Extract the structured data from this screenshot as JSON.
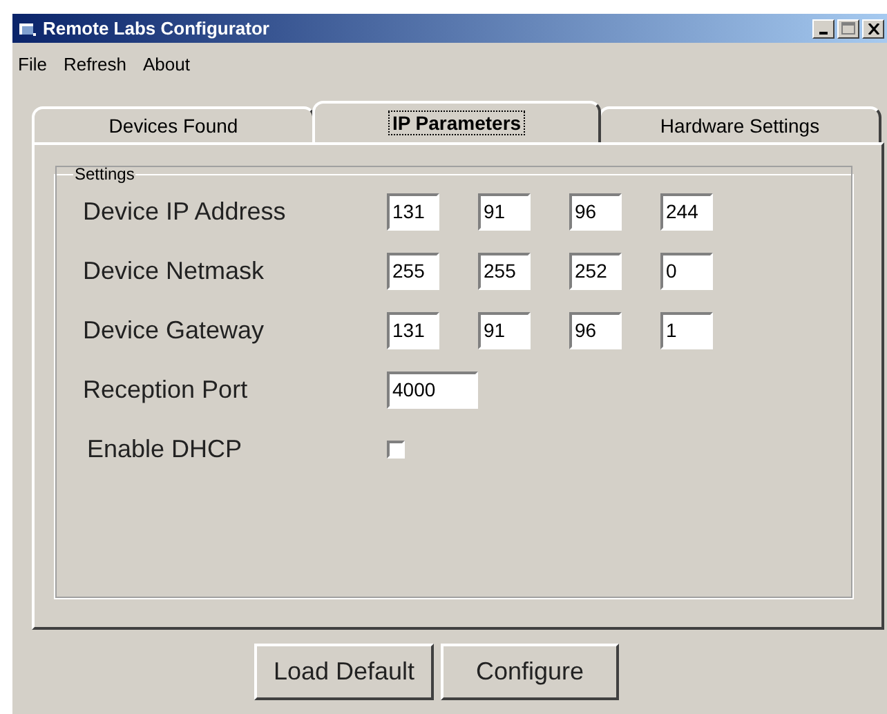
{
  "window": {
    "title": "Remote Labs Configurator"
  },
  "menu": [
    "File",
    "Refresh",
    "About"
  ],
  "tabs": [
    {
      "label": "Devices Found",
      "selected": false
    },
    {
      "label": "IP Parameters",
      "selected": true
    },
    {
      "label": "Hardware Settings",
      "selected": false
    }
  ],
  "settings": {
    "title": "Settings",
    "rows": [
      {
        "kind": "ip",
        "label": "Device IP Address",
        "values": [
          "131",
          "91",
          "96",
          "244"
        ]
      },
      {
        "kind": "ip",
        "label": "Device Netmask",
        "values": [
          "255",
          "255",
          "252",
          "0"
        ]
      },
      {
        "kind": "ip",
        "label": "Device Gateway",
        "values": [
          "131",
          "91",
          "96",
          "1"
        ]
      },
      {
        "kind": "port",
        "label": "Reception Port",
        "values": [
          "4000"
        ]
      },
      {
        "kind": "checkbox",
        "label": "Enable DHCP",
        "checked": false
      }
    ]
  },
  "buttons": [
    "Load Default",
    "Configure"
  ]
}
